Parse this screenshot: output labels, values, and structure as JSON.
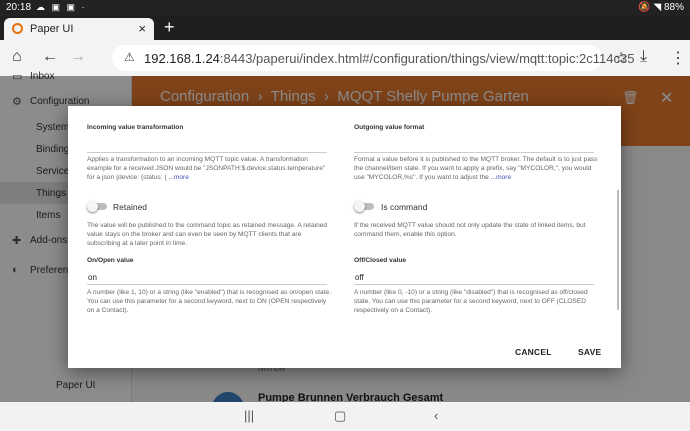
{
  "status_bar": {
    "time": "20:18",
    "battery": "88%"
  },
  "browser": {
    "tab_title": "Paper UI",
    "url_host": "192.168.1.24",
    "url_rest": ":8443/paperui/index.html#/configuration/things/view/mqtt:topic:2c114c35"
  },
  "sidebar": {
    "partial_top": "Inbox",
    "items": [
      {
        "label": "Configuration"
      },
      {
        "label": "System"
      },
      {
        "label": "Bindings"
      },
      {
        "label": "Services"
      },
      {
        "label": "Things"
      },
      {
        "label": "Items"
      },
      {
        "label": "Add-ons"
      },
      {
        "label": "Preferences"
      }
    ],
    "footer": "Paper UI"
  },
  "header": {
    "crumb1": "Configuration",
    "crumb2": "Things",
    "crumb3": "MQQT Shelly Pumpe Garten"
  },
  "background": {
    "row_subtitle": "Number",
    "row_title": "Pumpe Brunnen Verbrauch Gesamt"
  },
  "dialog": {
    "incoming": {
      "label": "Incoming value transformation",
      "desc": "Applies a transformation to an incoming MQTT topic value. A transformation example for a received JSON would be \"JSONPATH:$.device.status.temperature\" for a json {device: {status: {",
      "more": "...more"
    },
    "outgoing": {
      "label": "Outgoing value format",
      "desc": "Format a value before it is published to the MQTT broker. The default is to just pass the channel/item state. If you want to apply a prefix, say \"MYCOLOR,\", you would use \"MYCOLOR,%s\". If you want to adjust the",
      "more": "...more"
    },
    "retained": {
      "label": "Retained",
      "desc": "The value will be published to the command topic as retained message. A retained value stays on the broker and can even be seen by MQTT clients that are subscribing at a later point in time."
    },
    "is_command": {
      "label": "Is command",
      "desc": "If the received MQTT value should not only update the state of linked items, but command them, enable this option."
    },
    "on_open": {
      "label": "On/Open value",
      "value": "on",
      "desc": "A number (like 1, 10) or a string (like \"enabled\") that is recognised as on/open state. You can use this parameter for a second keyword, next to ON (OPEN respectively on a Contact)."
    },
    "off_closed": {
      "label": "Off/Closed value",
      "value": "off",
      "desc": "A number (like 0, -10) or a string (like \"disabled\") that is recognised as off/closed state. You can use this parameter for a second keyword, next to OFF (CLOSED respectively on a Contact)."
    },
    "cancel": "CANCEL",
    "save": "SAVE"
  },
  "colors": {
    "header": "#e87a2e",
    "link": "#3f51b5"
  }
}
